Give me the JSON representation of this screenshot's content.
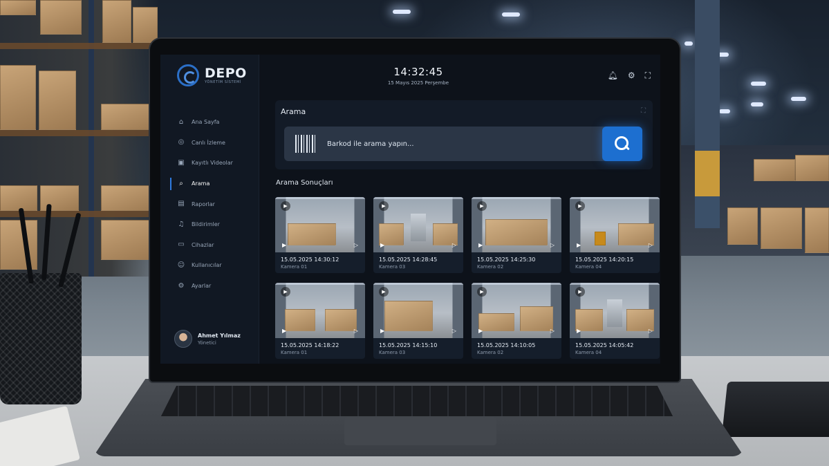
{
  "app": {
    "logo_name": "DEPO",
    "logo_subtitle": "YÖNETİM SİSTEMİ"
  },
  "header": {
    "time": "14:32:45",
    "date": "15 Mayıs 2025 Perşembe",
    "icons": [
      "bell-icon",
      "gear-icon",
      "fullscreen-icon"
    ]
  },
  "sidebar": {
    "items": [
      {
        "label": "Ana Sayfa",
        "icon": "home-icon",
        "active": false
      },
      {
        "label": "Canlı İzleme",
        "icon": "live-camera-icon",
        "active": false
      },
      {
        "label": "Kayıtlı Videolar",
        "icon": "video-icon",
        "active": false
      },
      {
        "label": "Arama",
        "icon": "search-icon",
        "active": true
      },
      {
        "label": "Raporlar",
        "icon": "report-icon",
        "active": false
      },
      {
        "label": "Bildirimler",
        "icon": "bell-icon",
        "active": false
      },
      {
        "label": "Cihazlar",
        "icon": "device-icon",
        "active": false
      },
      {
        "label": "Kullanıcılar",
        "icon": "users-icon",
        "active": false
      },
      {
        "label": "Ayarlar",
        "icon": "gear-icon",
        "active": false
      }
    ],
    "user": {
      "name": "Ahmet Yılmaz",
      "role": "Yönetici"
    }
  },
  "search": {
    "title": "Arama",
    "placeholder": "Barkod ile arama yapın...",
    "value": ""
  },
  "results": {
    "title": "Arama Sonuçları",
    "items": [
      {
        "timestamp": "15.05.2025 14:30:12",
        "camera": "Kamera 01"
      },
      {
        "timestamp": "15.05.2025 14:28:45",
        "camera": "Kamera 03"
      },
      {
        "timestamp": "15.05.2025 14:25:30",
        "camera": "Kamera 02"
      },
      {
        "timestamp": "15.05.2025 14:20:15",
        "camera": "Kamera 04"
      },
      {
        "timestamp": "15.05.2025 14:18:22",
        "camera": "Kamera 01"
      },
      {
        "timestamp": "15.05.2025 14:15:10",
        "camera": "Kamera 03"
      },
      {
        "timestamp": "15.05.2025 14:10:05",
        "camera": "Kamera 02"
      },
      {
        "timestamp": "15.05.2025 14:05:42",
        "camera": "Kamera 04"
      }
    ]
  },
  "colors": {
    "accent": "#1d6fd0",
    "screen_bg": "#0d121a",
    "sidebar_bg": "#111823"
  }
}
